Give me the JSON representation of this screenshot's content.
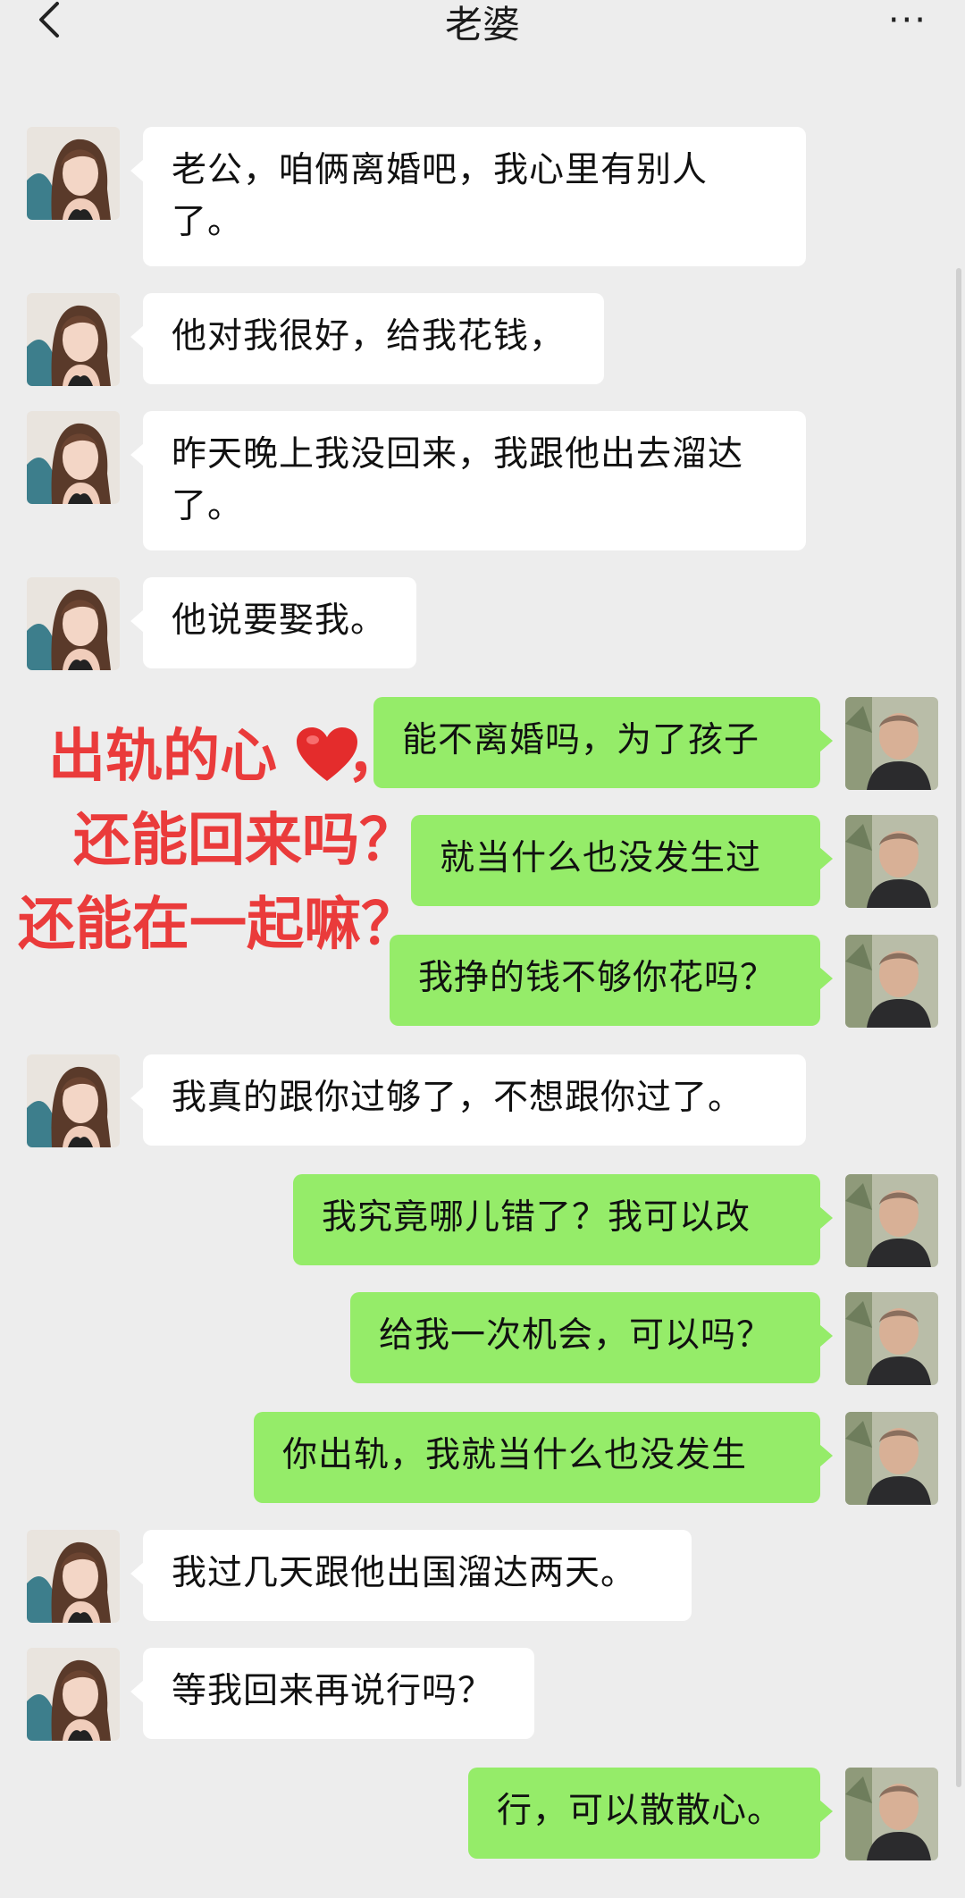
{
  "header": {
    "title": "老婆",
    "back_icon": "chevron-left-icon",
    "more_label": "···"
  },
  "colors": {
    "background": "#ededed",
    "incoming_bubble": "#ffffff",
    "outgoing_bubble": "#95ec69",
    "overlay_text": "#ea3b3b"
  },
  "messages": [
    {
      "side": "left",
      "text": "老公，咱俩离婚吧，我心里有别人了。"
    },
    {
      "side": "left",
      "text": "他对我很好，给我花钱，"
    },
    {
      "side": "left",
      "text": "昨天晚上我没回来，我跟他出去溜达了。"
    },
    {
      "side": "left",
      "text": "他说要娶我。"
    },
    {
      "side": "right",
      "text": "能不离婚吗，为了孩子"
    },
    {
      "side": "right",
      "text": "就当什么也没发生过"
    },
    {
      "side": "right",
      "text": "我挣的钱不够你花吗？"
    },
    {
      "side": "left",
      "text": "我真的跟你过够了，不想跟你过了。"
    },
    {
      "side": "right",
      "text": "我究竟哪儿错了？我可以改"
    },
    {
      "side": "right",
      "text": "给我一次机会，可以吗？"
    },
    {
      "side": "right",
      "text": "你出轨，我就当什么也没发生"
    },
    {
      "side": "left",
      "text": "我过几天跟他出国溜达两天。"
    },
    {
      "side": "left",
      "text": "等我回来再说行吗？"
    },
    {
      "side": "right",
      "text": "行，可以散散心。"
    }
  ],
  "overlay": {
    "line1": "出轨的心",
    "line1_suffix": "，",
    "line2": "还能回来吗？",
    "line3": "还能在一起嘛？",
    "heart_icon": "red-heart-icon"
  }
}
